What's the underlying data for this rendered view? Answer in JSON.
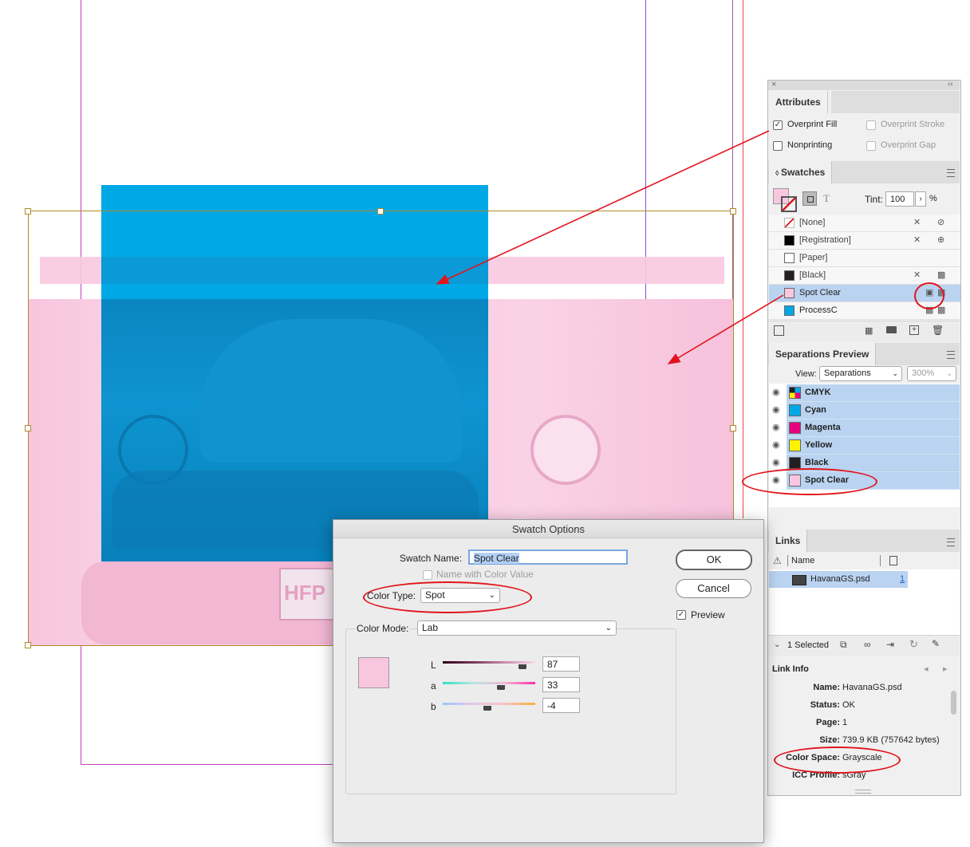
{
  "canvas": {
    "plate_text": "HFP"
  },
  "colors": {
    "cyan": "#00a8e6",
    "spot_pink": "#f9c6e0",
    "selection_blue": "#b9d3f0",
    "annotation_red": "#e1141c",
    "guide_magenta": "#c040c0"
  },
  "attributes": {
    "tab": "Attributes",
    "overprint_fill": "Overprint Fill",
    "overprint_fill_checked": true,
    "overprint_stroke": "Overprint Stroke",
    "nonprinting": "Nonprinting",
    "overprint_gap": "Overprint Gap"
  },
  "swatches": {
    "tab": "Swatches",
    "tint_label": "Tint:",
    "tint_value": "100",
    "percent": "%",
    "type_glyph": "T",
    "items": [
      {
        "name": "[None]",
        "color": "none"
      },
      {
        "name": "[Registration]",
        "color": "#000000"
      },
      {
        "name": "[Paper]",
        "color": "#ffffff"
      },
      {
        "name": "[Black]",
        "color": "#231f20"
      },
      {
        "name": "Spot Clear",
        "color": "#f9c6e0",
        "selected": true
      },
      {
        "name": "ProcessC",
        "color": "#00a8e6"
      }
    ]
  },
  "separations": {
    "tab": "Separations Preview",
    "view_label": "View:",
    "view_value": "Separations",
    "zoom_value": "300%",
    "items": [
      {
        "name": "CMYK",
        "color": "cmyk"
      },
      {
        "name": "Cyan",
        "color": "#00a8e6"
      },
      {
        "name": "Magenta",
        "color": "#e6007e"
      },
      {
        "name": "Yellow",
        "color": "#fff200"
      },
      {
        "name": "Black",
        "color": "#231f20"
      },
      {
        "name": "Spot Clear",
        "color": "#f9c6e0"
      }
    ]
  },
  "links": {
    "tab": "Links",
    "col_name": "Name",
    "file_name": "HavanaGS.psd",
    "page_num": "1",
    "selected_count": "1 Selected",
    "info_title": "Link Info",
    "info": [
      {
        "key": "Name:",
        "value": "HavanaGS.psd"
      },
      {
        "key": "Status:",
        "value": "OK"
      },
      {
        "key": "Page:",
        "value": "1"
      },
      {
        "key": "Size:",
        "value": "739.9 KB (757642 bytes)"
      },
      {
        "key": "Color Space:",
        "value": "Grayscale"
      },
      {
        "key": "ICC Profile:",
        "value": "sGray"
      }
    ]
  },
  "dialog": {
    "title": "Swatch Options",
    "swatch_name_label": "Swatch Name:",
    "swatch_name_value": "Spot Clear",
    "name_with_color_value": "Name with Color Value",
    "color_type_label": "Color Type:",
    "color_type_value": "Spot",
    "color_mode_label": "Color Mode:",
    "color_mode_value": "Lab",
    "ok": "OK",
    "cancel": "Cancel",
    "preview": "Preview",
    "preview_checked": true,
    "l_label": "L",
    "l_value": "87",
    "a_label": "a",
    "a_value": "33",
    "b_label": "b",
    "b_value": "-4"
  }
}
